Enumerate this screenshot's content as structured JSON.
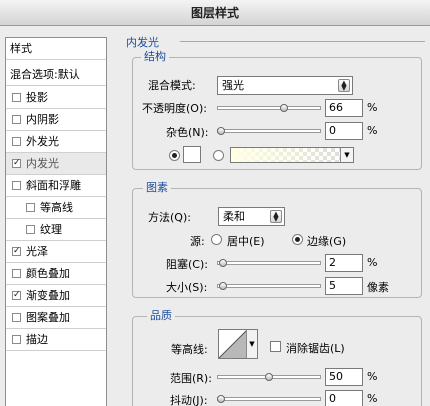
{
  "window": {
    "title": "图层样式"
  },
  "sidebar": {
    "header": "样式",
    "blend_options": "混合选项:默认",
    "items": [
      {
        "label": "投影",
        "checked": false,
        "indent": false,
        "selected": false
      },
      {
        "label": "内阴影",
        "checked": false,
        "indent": false,
        "selected": false
      },
      {
        "label": "外发光",
        "checked": false,
        "indent": false,
        "selected": false
      },
      {
        "label": "内发光",
        "checked": true,
        "indent": false,
        "selected": true
      },
      {
        "label": "斜面和浮雕",
        "checked": false,
        "indent": false,
        "selected": false
      },
      {
        "label": "等高线",
        "checked": false,
        "indent": true,
        "selected": false
      },
      {
        "label": "纹理",
        "checked": false,
        "indent": true,
        "selected": false
      },
      {
        "label": "光泽",
        "checked": true,
        "indent": false,
        "selected": false
      },
      {
        "label": "颜色叠加",
        "checked": false,
        "indent": false,
        "selected": false
      },
      {
        "label": "渐变叠加",
        "checked": true,
        "indent": false,
        "selected": false
      },
      {
        "label": "图案叠加",
        "checked": false,
        "indent": false,
        "selected": false
      },
      {
        "label": "描边",
        "checked": false,
        "indent": false,
        "selected": false
      }
    ],
    "check_glyph": "✓"
  },
  "panel": {
    "title": "内发光",
    "structure": {
      "legend": "结构",
      "blend_mode_label": "混合模式:",
      "blend_mode_value": "强光",
      "opacity_label": "不透明度(O):",
      "opacity_value": "66",
      "opacity_unit": "%",
      "opacity_fraction": 0.66,
      "noise_label": "杂色(N):",
      "noise_value": "0",
      "noise_unit": "%",
      "noise_fraction": 0.0
    },
    "elements": {
      "legend": "图素",
      "method_label": "方法(Q):",
      "method_value": "柔和",
      "source_label": "源:",
      "center_label": "居中(E)",
      "edge_label": "边缘(G)",
      "choke_label": "阻塞(C):",
      "choke_value": "2",
      "choke_unit": "%",
      "choke_fraction": 0.02,
      "size_label": "大小(S):",
      "size_value": "5",
      "size_unit": "像素",
      "size_fraction": 0.02
    },
    "quality": {
      "legend": "品质",
      "contour_label": "等高线:",
      "antialias_label": "消除锯齿(L)",
      "range_label": "范围(R):",
      "range_value": "50",
      "range_unit": "%",
      "range_fraction": 0.5,
      "jitter_label": "抖动(J):",
      "jitter_value": "0",
      "jitter_unit": "%",
      "jitter_fraction": 0.0
    }
  }
}
